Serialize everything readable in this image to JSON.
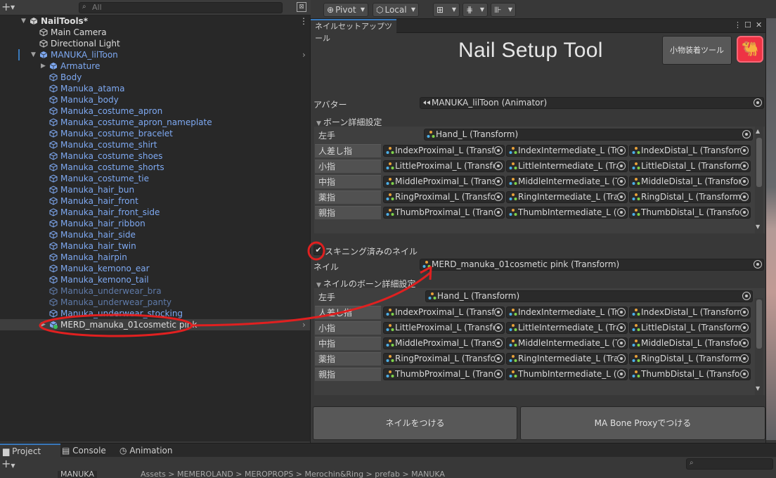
{
  "hierarchy": {
    "search_placeholder": "All",
    "scene_name": "NailTools*",
    "items": [
      {
        "label": "Main Camera",
        "style": "white"
      },
      {
        "label": "Directional Light",
        "style": "white"
      },
      {
        "label": "MANUKA_lilToon",
        "style": "blue"
      },
      {
        "label": "Armature",
        "style": "blue"
      },
      {
        "label": "Body",
        "style": "blue"
      },
      {
        "label": "Manuka_atama",
        "style": "blue"
      },
      {
        "label": "Manuka_body",
        "style": "blue"
      },
      {
        "label": "Manuka_costume_apron",
        "style": "blue"
      },
      {
        "label": "Manuka_costume_apron_nameplate",
        "style": "blue"
      },
      {
        "label": "Manuka_costume_bracelet",
        "style": "blue"
      },
      {
        "label": "Manuka_costume_shirt",
        "style": "blue"
      },
      {
        "label": "Manuka_costume_shoes",
        "style": "blue"
      },
      {
        "label": "Manuka_costume_shorts",
        "style": "blue"
      },
      {
        "label": "Manuka_costume_tie",
        "style": "blue"
      },
      {
        "label": "Manuka_hair_bun",
        "style": "blue"
      },
      {
        "label": "Manuka_hair_front",
        "style": "blue"
      },
      {
        "label": "Manuka_hair_front_side",
        "style": "blue"
      },
      {
        "label": "Manuka_hair_ribbon",
        "style": "blue"
      },
      {
        "label": "Manuka_hair_side",
        "style": "blue"
      },
      {
        "label": "Manuka_hair_twin",
        "style": "blue"
      },
      {
        "label": "Manuka_hairpin",
        "style": "blue"
      },
      {
        "label": "Manuka_kemono_ear",
        "style": "blue"
      },
      {
        "label": "Manuka_kemono_tail",
        "style": "blue"
      },
      {
        "label": "Manuka_underwear_bra",
        "style": "dim"
      },
      {
        "label": "Manuka_underwear_panty",
        "style": "dim"
      },
      {
        "label": "Manuka_underwear_stocking",
        "style": "blue"
      },
      {
        "label": "MERD_manuka_01cosmetic pink",
        "style": "white"
      }
    ]
  },
  "scene_toolbar": {
    "pivot": "Pivot",
    "local": "Local"
  },
  "tool": {
    "tab_label": "ネイルセットアップツール",
    "title": "Nail Setup Tool",
    "small_tool_button": "小物装着ツール",
    "logo_glyph": "🐫",
    "avatar_label": "アバター",
    "avatar_value": "MANUKA_lilToon (Animator)",
    "bone_section_title": "ボーン詳細設定",
    "hand_label": "左手",
    "hand_value": "Hand_L (Transform)",
    "fingers": [
      {
        "name": "人差し指",
        "proximal": "IndexProximal_L (Transform)",
        "intermediate": "IndexIntermediate_L (Transform)",
        "distal": "IndexDistal_L (Transform)"
      },
      {
        "name": "小指",
        "proximal": "LittleProximal_L (Transform)",
        "intermediate": "LittleIntermediate_L (Transform)",
        "distal": "LittleDistal_L (Transform)"
      },
      {
        "name": "中指",
        "proximal": "MiddleProximal_L (Transform)",
        "intermediate": "MiddleIntermediate_L (Transform)",
        "distal": "MiddleDistal_L (Transform)"
      },
      {
        "name": "薬指",
        "proximal": "RingProximal_L (Transform)",
        "intermediate": "RingIntermediate_L (Transform)",
        "distal": "RingDistal_L (Transform)"
      },
      {
        "name": "親指",
        "proximal": "ThumbProximal_L (Transform)",
        "intermediate": "ThumbIntermediate_L (Transform)",
        "distal": "ThumbDistal_L (Transform)"
      }
    ],
    "skinned_label": "スキニング済みのネイル",
    "skinned_checked": true,
    "nail_label": "ネイル",
    "nail_value": "MERD_manuka_01cosmetic pink (Transform)",
    "nail_bone_section_title": "ネイルのボーン詳細設定",
    "nail_hand_label": "左手",
    "nail_hand_value": "Hand_L (Transform)",
    "attach_button": "ネイルをつける",
    "ma_button": "MA Bone Proxyでつける"
  },
  "bottom": {
    "tabs": [
      "Project",
      "Console",
      "Animation"
    ],
    "active_tab": "Project",
    "folder": "MANUKA",
    "crumbs": "Assets  >  MEMEROLAND  >  MEROPROPS  >  Merochin&Ring  >  prefab  >  MANUKA"
  },
  "colors": {
    "accent": "#3a79bb",
    "prefab_blue": "#7ea9f2",
    "annotation_red": "#e02020",
    "logo_red": "#ee3344"
  }
}
